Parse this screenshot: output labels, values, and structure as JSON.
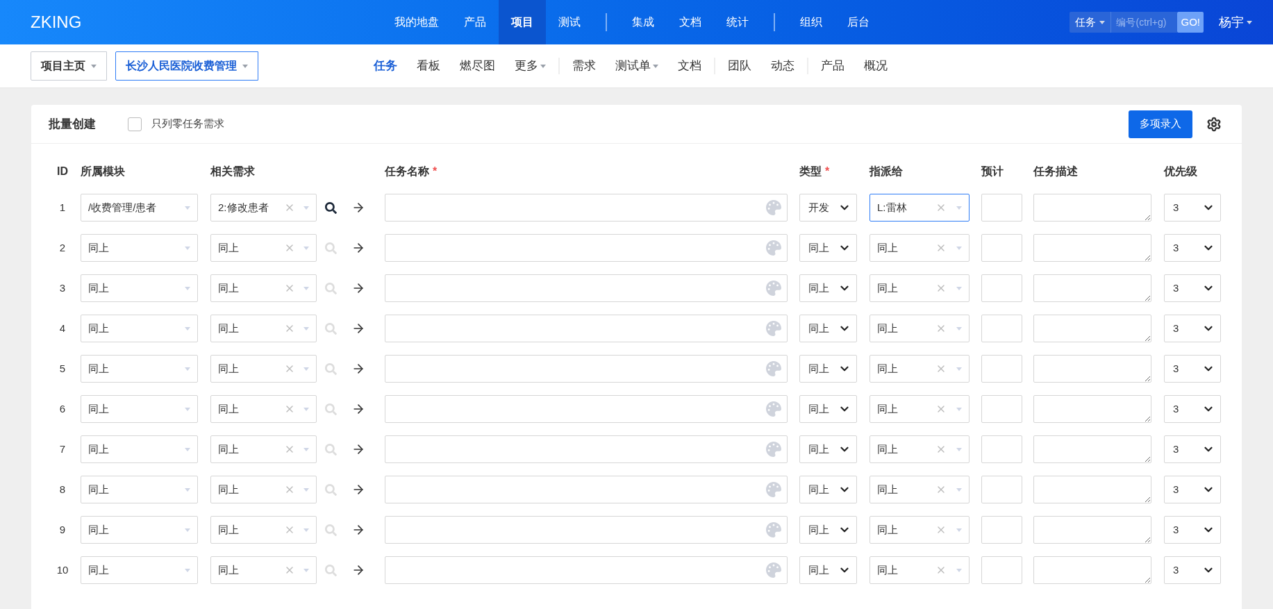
{
  "brand": "ZKING",
  "main_nav": [
    [
      {
        "label": "我的地盘",
        "selected": false
      },
      {
        "label": "产品",
        "selected": false
      },
      {
        "label": "项目",
        "selected": true
      },
      {
        "label": "测试",
        "selected": false
      }
    ],
    [
      {
        "label": "集成",
        "selected": false
      },
      {
        "label": "文档",
        "selected": false
      },
      {
        "label": "统计",
        "selected": false
      }
    ],
    [
      {
        "label": "组织",
        "selected": false
      },
      {
        "label": "后台",
        "selected": false
      }
    ]
  ],
  "quick_search": {
    "type": "任务",
    "placeholder": "编号(ctrl+g)",
    "button": "GO!"
  },
  "user": "杨宇",
  "breadcrumb": [
    {
      "label": "项目主页",
      "selected": false
    },
    {
      "label": "长沙人民医院收费管理",
      "selected": true
    }
  ],
  "sub_nav": [
    [
      {
        "label": "任务",
        "selected": true,
        "dropdown": false
      },
      {
        "label": "看板",
        "selected": false,
        "dropdown": false
      },
      {
        "label": "燃尽图",
        "selected": false,
        "dropdown": false
      },
      {
        "label": "更多",
        "selected": false,
        "dropdown": true
      }
    ],
    [
      {
        "label": "需求",
        "selected": false,
        "dropdown": false
      },
      {
        "label": "测试单",
        "selected": false,
        "dropdown": true
      },
      {
        "label": "文档",
        "selected": false,
        "dropdown": false
      }
    ],
    [
      {
        "label": "团队",
        "selected": false,
        "dropdown": false
      },
      {
        "label": "动态",
        "selected": false,
        "dropdown": false
      }
    ],
    [
      {
        "label": "产品",
        "selected": false,
        "dropdown": false
      },
      {
        "label": "概况",
        "selected": false,
        "dropdown": false
      }
    ]
  ],
  "panel": {
    "title": "批量创建",
    "filter": {
      "label": "只列零任务需求",
      "checked": false
    },
    "button": "多项录入"
  },
  "columns": [
    {
      "label": "ID"
    },
    {
      "label": "所属模块"
    },
    {
      "label": "相关需求"
    },
    {
      "label": "任务名称",
      "required_mark": "*"
    },
    {
      "label": "类型",
      "required_mark": "*"
    },
    {
      "label": "指派给"
    },
    {
      "label": "预计"
    },
    {
      "label": "任务描述"
    },
    {
      "label": "优先级"
    }
  ],
  "rows": [
    {
      "id": "1",
      "module": "/收费管理/患者",
      "story": "2:修改患者",
      "search_enabled": true,
      "type": "开发",
      "assignee": "L:雷林",
      "assignee_focused": true,
      "priority": "3"
    },
    {
      "id": "2",
      "module": "同上",
      "story": "同上",
      "search_enabled": false,
      "type": "同上",
      "assignee": "同上",
      "assignee_focused": false,
      "priority": "3"
    },
    {
      "id": "3",
      "module": "同上",
      "story": "同上",
      "search_enabled": false,
      "type": "同上",
      "assignee": "同上",
      "assignee_focused": false,
      "priority": "3"
    },
    {
      "id": "4",
      "module": "同上",
      "story": "同上",
      "search_enabled": false,
      "type": "同上",
      "assignee": "同上",
      "assignee_focused": false,
      "priority": "3"
    },
    {
      "id": "5",
      "module": "同上",
      "story": "同上",
      "search_enabled": false,
      "type": "同上",
      "assignee": "同上",
      "assignee_focused": false,
      "priority": "3"
    },
    {
      "id": "6",
      "module": "同上",
      "story": "同上",
      "search_enabled": false,
      "type": "同上",
      "assignee": "同上",
      "assignee_focused": false,
      "priority": "3"
    },
    {
      "id": "7",
      "module": "同上",
      "story": "同上",
      "search_enabled": false,
      "type": "同上",
      "assignee": "同上",
      "assignee_focused": false,
      "priority": "3"
    },
    {
      "id": "8",
      "module": "同上",
      "story": "同上",
      "search_enabled": false,
      "type": "同上",
      "assignee": "同上",
      "assignee_focused": false,
      "priority": "3"
    },
    {
      "id": "9",
      "module": "同上",
      "story": "同上",
      "search_enabled": false,
      "type": "同上",
      "assignee": "同上",
      "assignee_focused": false,
      "priority": "3"
    },
    {
      "id": "10",
      "module": "同上",
      "story": "同上",
      "search_enabled": false,
      "type": "同上",
      "assignee": "同上",
      "assignee_focused": false,
      "priority": "3"
    }
  ]
}
